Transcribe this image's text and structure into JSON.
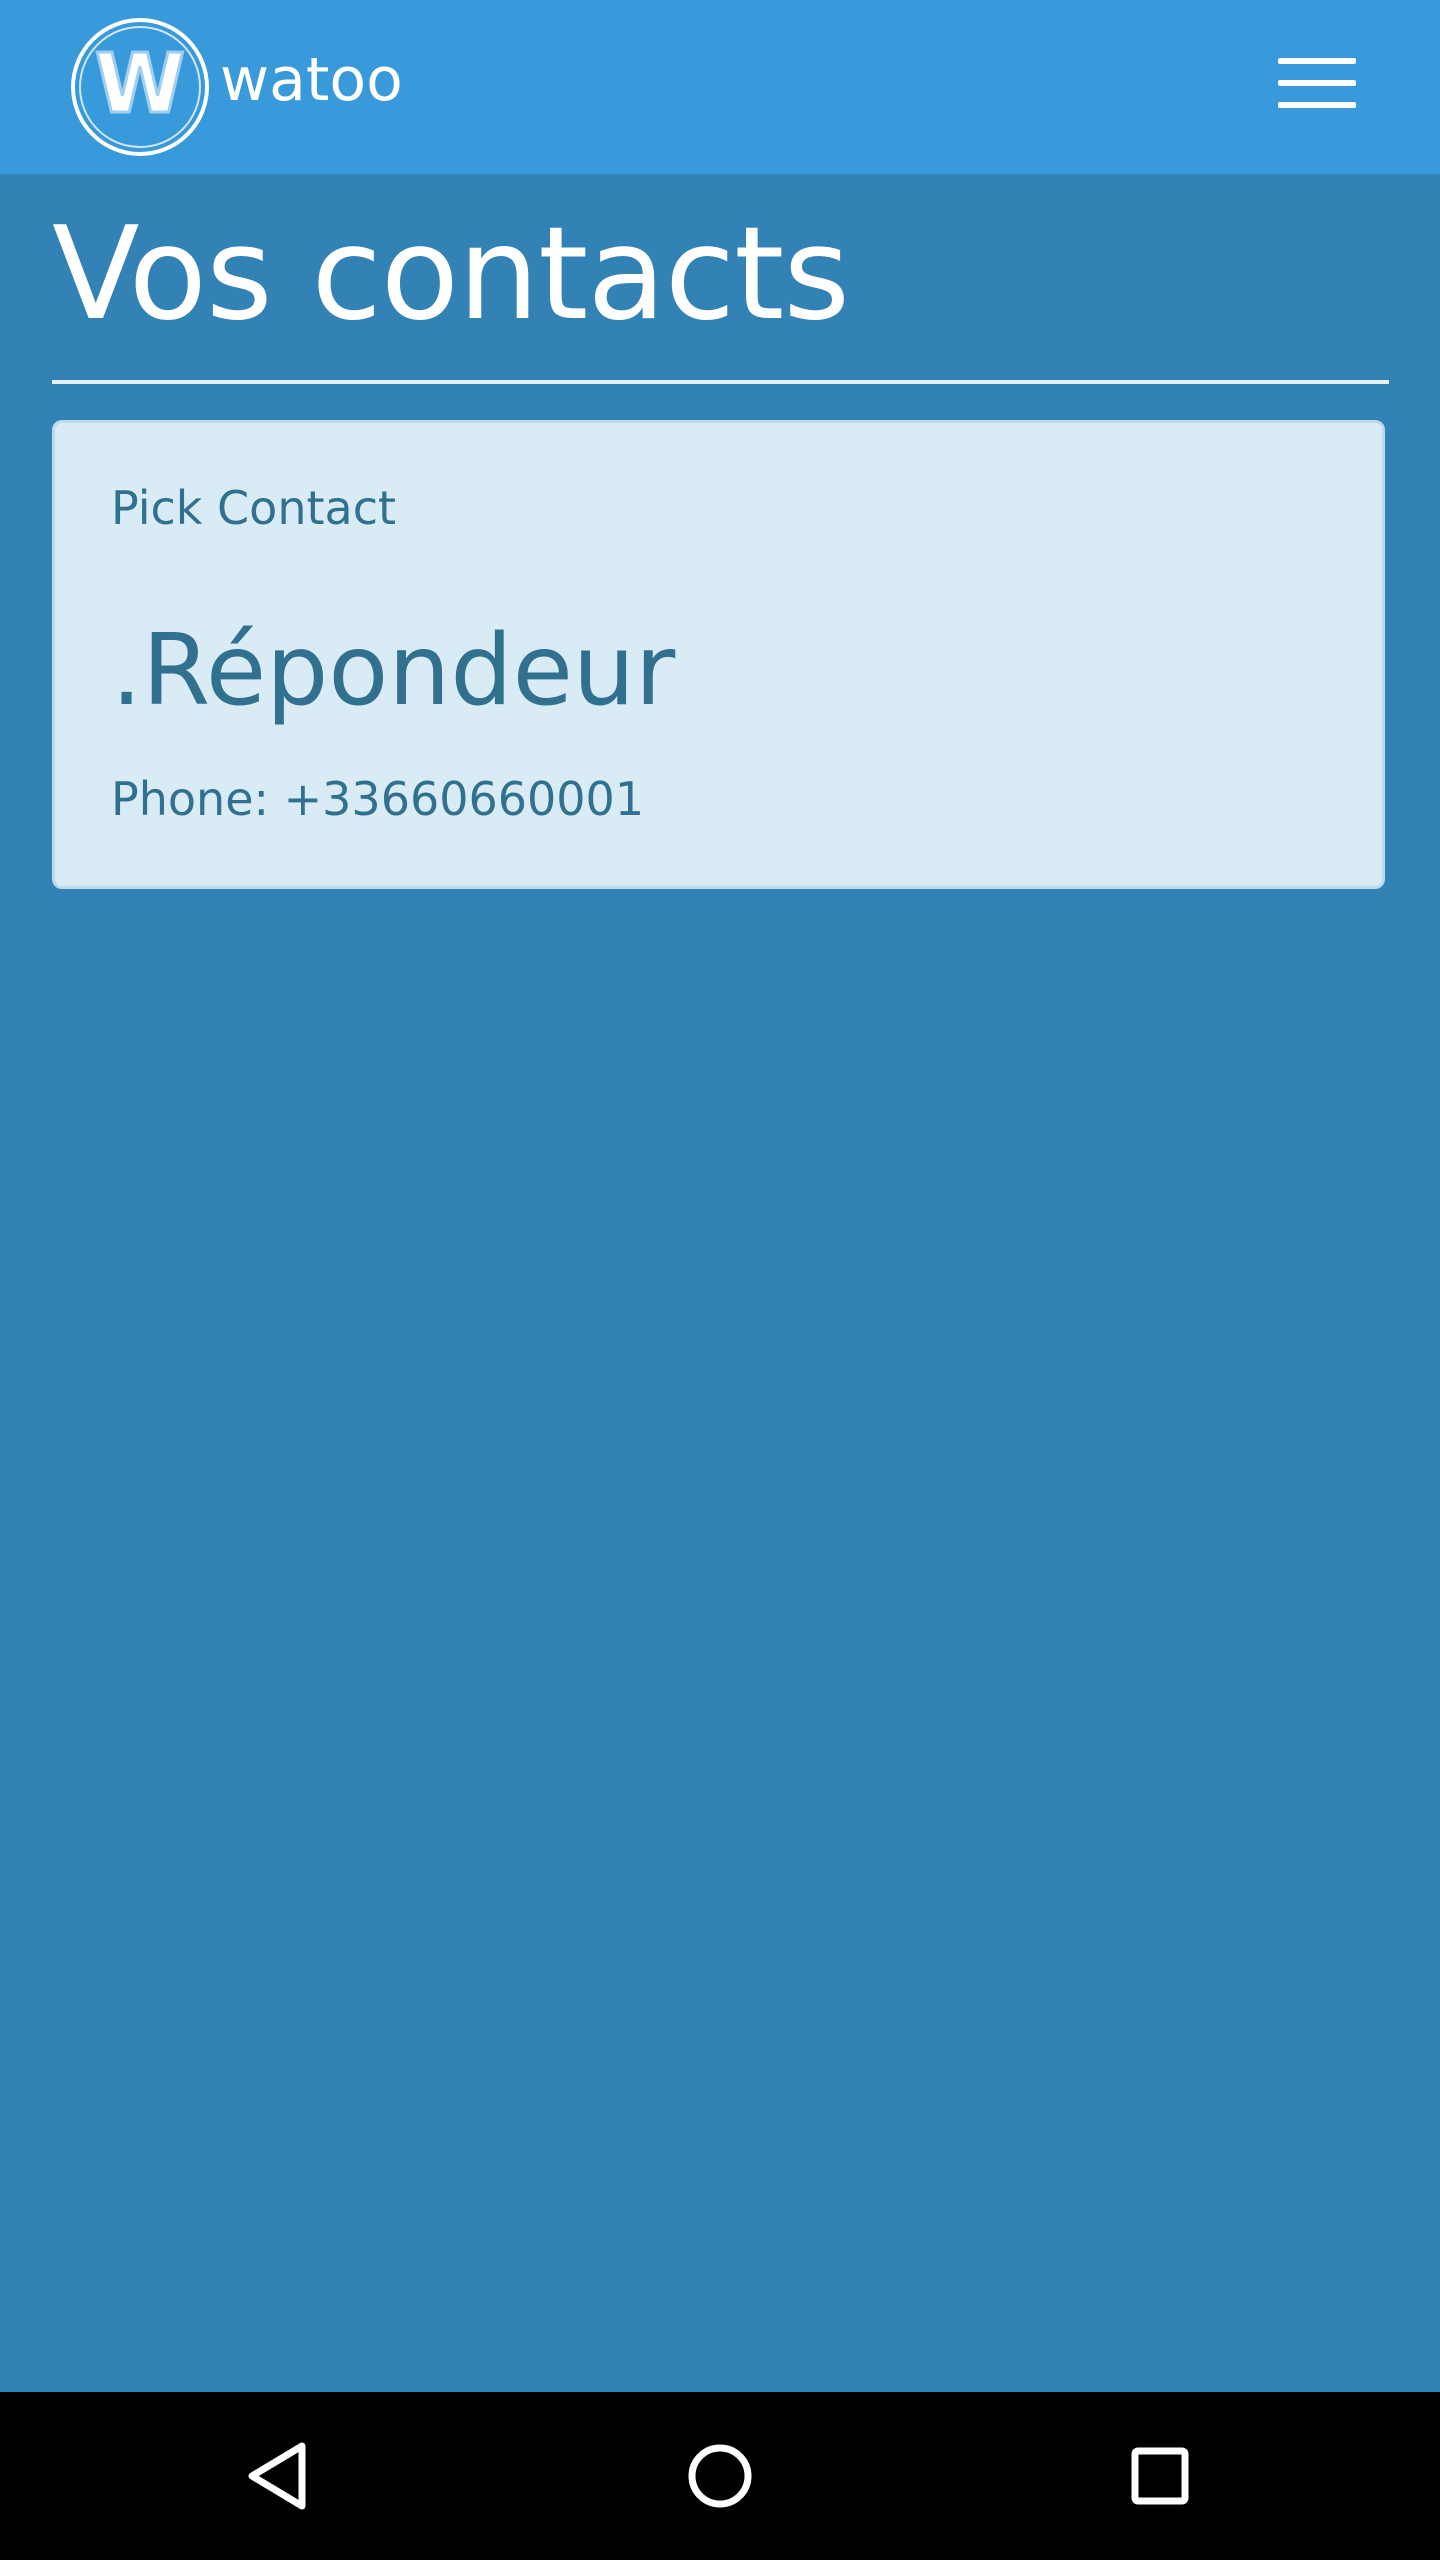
{
  "app_bar": {
    "brand_name": "watoo",
    "logo_letter": "W",
    "logo_icon": "watoo-logo",
    "menu_icon": "hamburger-menu-icon"
  },
  "page": {
    "title": "Vos contacts"
  },
  "contact_card": {
    "kicker": "Pick Contact",
    "name": ".Répondeur",
    "phone": "Phone: +33660660001"
  },
  "nav_bar": {
    "back_icon": "back-triangle-icon",
    "home_icon": "home-circle-icon",
    "recents_icon": "recents-square-icon"
  },
  "colors": {
    "app_bar_bg": "#3899db",
    "page_bg": "#3382b5",
    "card_bg": "#d9ebf5",
    "card_text": "#31708f",
    "nav_bar_bg": "#000000"
  }
}
